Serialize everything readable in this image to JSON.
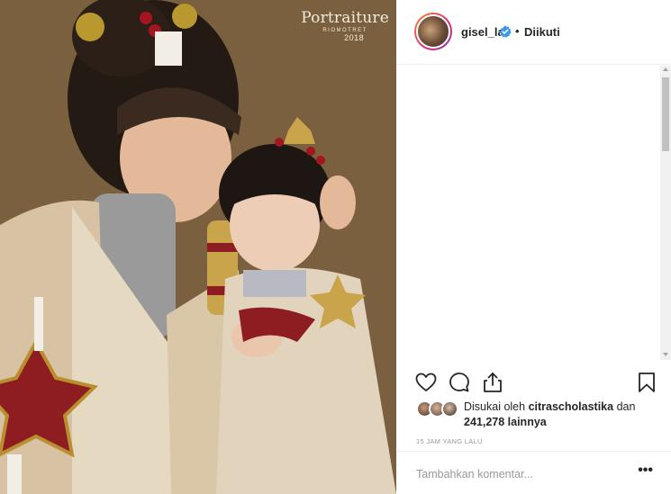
{
  "photo": {
    "watermark_title": "Portraiture",
    "watermark_sub": "RIOMOTRET",
    "watermark_year": "2018"
  },
  "post_header": {
    "username": "gisel_la",
    "separator": "•",
    "follow_status": "Diikuti",
    "verified_icon": "verified-badge-icon"
  },
  "actions": {
    "like_icon": "heart-icon",
    "comment_icon": "comment-icon",
    "share_icon": "share-icon",
    "save_icon": "bookmark-icon"
  },
  "likes": {
    "prefix": "Disukai oleh",
    "user": "citrascholastika",
    "conj": "dan",
    "count": "241,278 lainnya"
  },
  "timestamp": "15 JAM YANG LALU",
  "compose": {
    "placeholder": "Tambahkan komentar...",
    "more_label": "•••"
  },
  "colors": {
    "text": "#262626",
    "muted": "#999999",
    "verified": "#3897f0",
    "border": "#efefef"
  }
}
